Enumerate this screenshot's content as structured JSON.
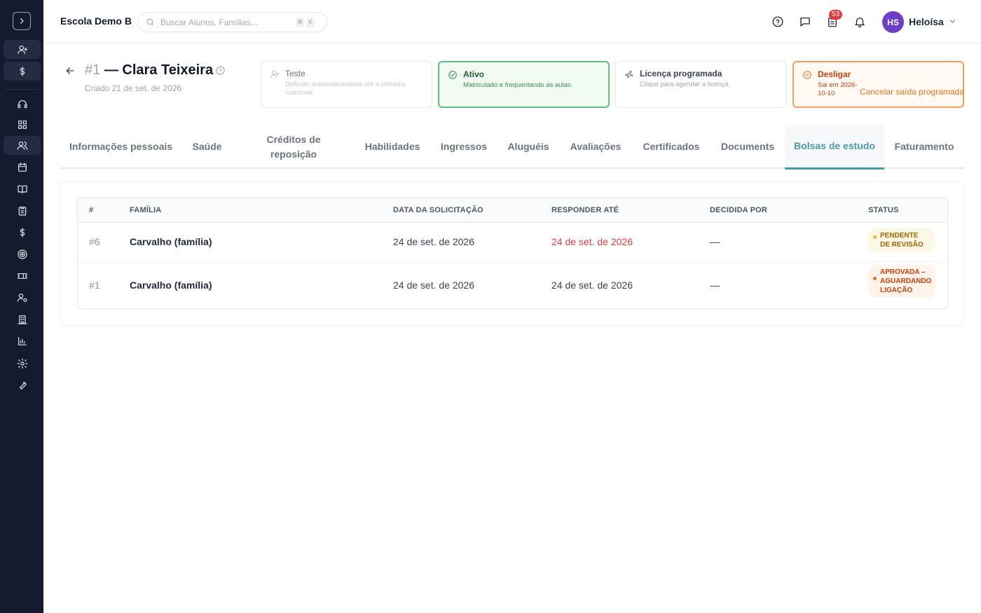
{
  "topbar": {
    "school_name": "Escola Demo B",
    "search_placeholder": "Buscar Alunos, Famílias...",
    "shortcut_keys": [
      "⌘",
      "K"
    ],
    "calendar_badge": "53",
    "user_initials": "HS",
    "user_name": "Heloísa"
  },
  "student": {
    "number": "#1",
    "name": "— Clara Teixeira",
    "created": "Criado 21 de set. de 2026"
  },
  "status_cards": [
    {
      "title": "Teste",
      "desc": "Definido automaticamente até a primeira matrícula."
    },
    {
      "title": "Ativo",
      "desc": "Matriculado e frequentando as aulas."
    },
    {
      "title": "Licença programada",
      "desc": "Clique para agendar a licença."
    },
    {
      "title": "Desligar",
      "desc": "Sai em 2026-10-10",
      "action": "Cancelar saída programada"
    }
  ],
  "tabs": [
    "Informações pessoais",
    "Saúde",
    "Créditos de reposição",
    "Habilidades",
    "Ingressos",
    "Aluguéis",
    "Avaliações",
    "Certificados",
    "Documents",
    "Bolsas de estudo",
    "Faturamento"
  ],
  "active_tab": "Bolsas de estudo",
  "table": {
    "headers": [
      "#",
      "FAMÍLIA",
      "DATA DA SOLICITAÇÃO",
      "RESPONDER ATÉ",
      "DECIDIDA POR",
      "STATUS"
    ],
    "rows": [
      {
        "id": "#6",
        "family": "Carvalho (família)",
        "requested": "24 de set. de 2026",
        "respond_by": "24 de set. de 2026",
        "decided_by": "—",
        "status": "PENDENTE DE REVISÃO"
      },
      {
        "id": "#1",
        "family": "Carvalho (família)",
        "requested": "24 de set. de 2026",
        "respond_by": "24 de set. de 2026",
        "decided_by": "—",
        "status": "APROVADA – AGUARDANDO LIGAÇÃO"
      }
    ]
  },
  "colors": {
    "rail": "#161a2e",
    "accent_teal": "#4a9aa2",
    "active_green": "#5cc27a",
    "danger_orange": "#f0a05c",
    "overdue_red": "#dc3d3d",
    "avatar_purple": "#6d3fc5"
  }
}
